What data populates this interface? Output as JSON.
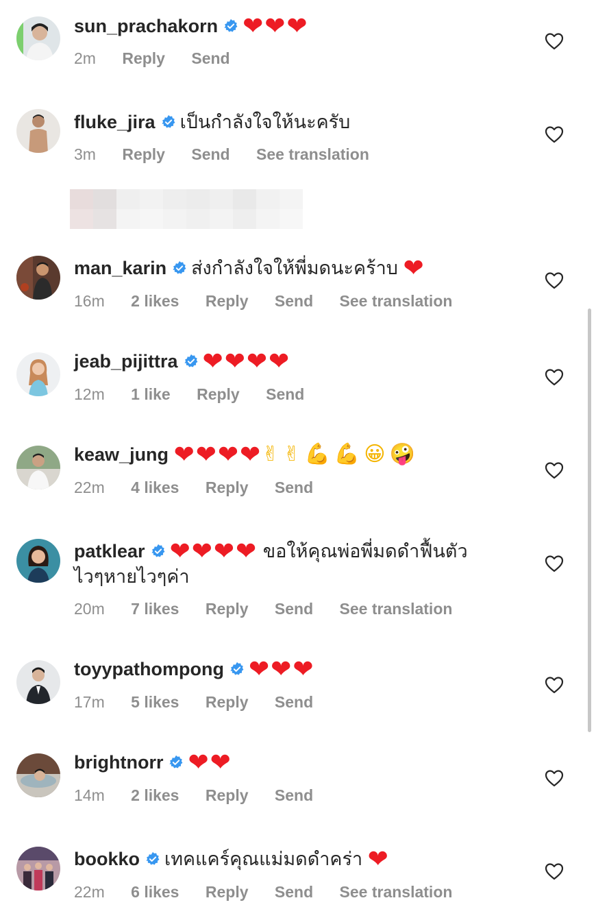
{
  "colors": {
    "text": "#262626",
    "meta": "#8e8e8e",
    "verified": "#3897f0",
    "heart_emoji": "#ed1c24"
  },
  "icons": {
    "verified": "verified-badge-icon",
    "like": "heart-outline-icon",
    "heart_emoji": "red-heart-emoji"
  },
  "comments": [
    {
      "username": "sun_prachakorn",
      "verified": true,
      "text": "",
      "emoji": "❤❤❤",
      "time": "2m",
      "likes": "",
      "reply": "Reply",
      "send": "Send",
      "translate": ""
    },
    {
      "username": "fluke_jira",
      "verified": true,
      "text": "เป็นกำลังใจให้นะครับ",
      "emoji": "",
      "time": "3m",
      "likes": "",
      "reply": "Reply",
      "send": "Send",
      "translate": "See translation"
    },
    {
      "username": "man_karin",
      "verified": true,
      "text": "ส่งกำลังใจให้พี่มดนะคร้าบ",
      "emoji": "❤",
      "time": "16m",
      "likes": "2 likes",
      "reply": "Reply",
      "send": "Send",
      "translate": "See translation"
    },
    {
      "username": "jeab_pijittra",
      "verified": true,
      "text": "",
      "emoji": "❤❤❤❤",
      "time": "12m",
      "likes": "1 like",
      "reply": "Reply",
      "send": "Send",
      "translate": ""
    },
    {
      "username": "keaw_jung",
      "verified": false,
      "text": "",
      "emoji": "❤❤❤❤",
      "emoji_extra": "✌✌💪💪😀🤪",
      "time": "22m",
      "likes": "4 likes",
      "reply": "Reply",
      "send": "Send",
      "translate": ""
    },
    {
      "username": "patklear",
      "verified": true,
      "text": "ขอให้คุณพ่อพี่มดดำฟื้นตัว",
      "text2": "ไวๆหายไวๆค่า",
      "emoji": "❤❤❤❤",
      "time": "20m",
      "likes": "7 likes",
      "reply": "Reply",
      "send": "Send",
      "translate": "See translation"
    },
    {
      "username": "toyypathompong",
      "verified": true,
      "text": "",
      "emoji": "❤❤❤",
      "time": "17m",
      "likes": "5 likes",
      "reply": "Reply",
      "send": "Send",
      "translate": ""
    },
    {
      "username": "brightnorr",
      "verified": true,
      "text": "",
      "emoji": "❤❤",
      "time": "14m",
      "likes": "2 likes",
      "reply": "Reply",
      "send": "Send",
      "translate": ""
    },
    {
      "username": "bookko",
      "verified": true,
      "text": "เทคแคร์คุณแม่มดดำคร่า",
      "emoji": "❤",
      "time": "22m",
      "likes": "6 likes",
      "reply": "Reply",
      "send": "Send",
      "translate": "See translation"
    }
  ]
}
